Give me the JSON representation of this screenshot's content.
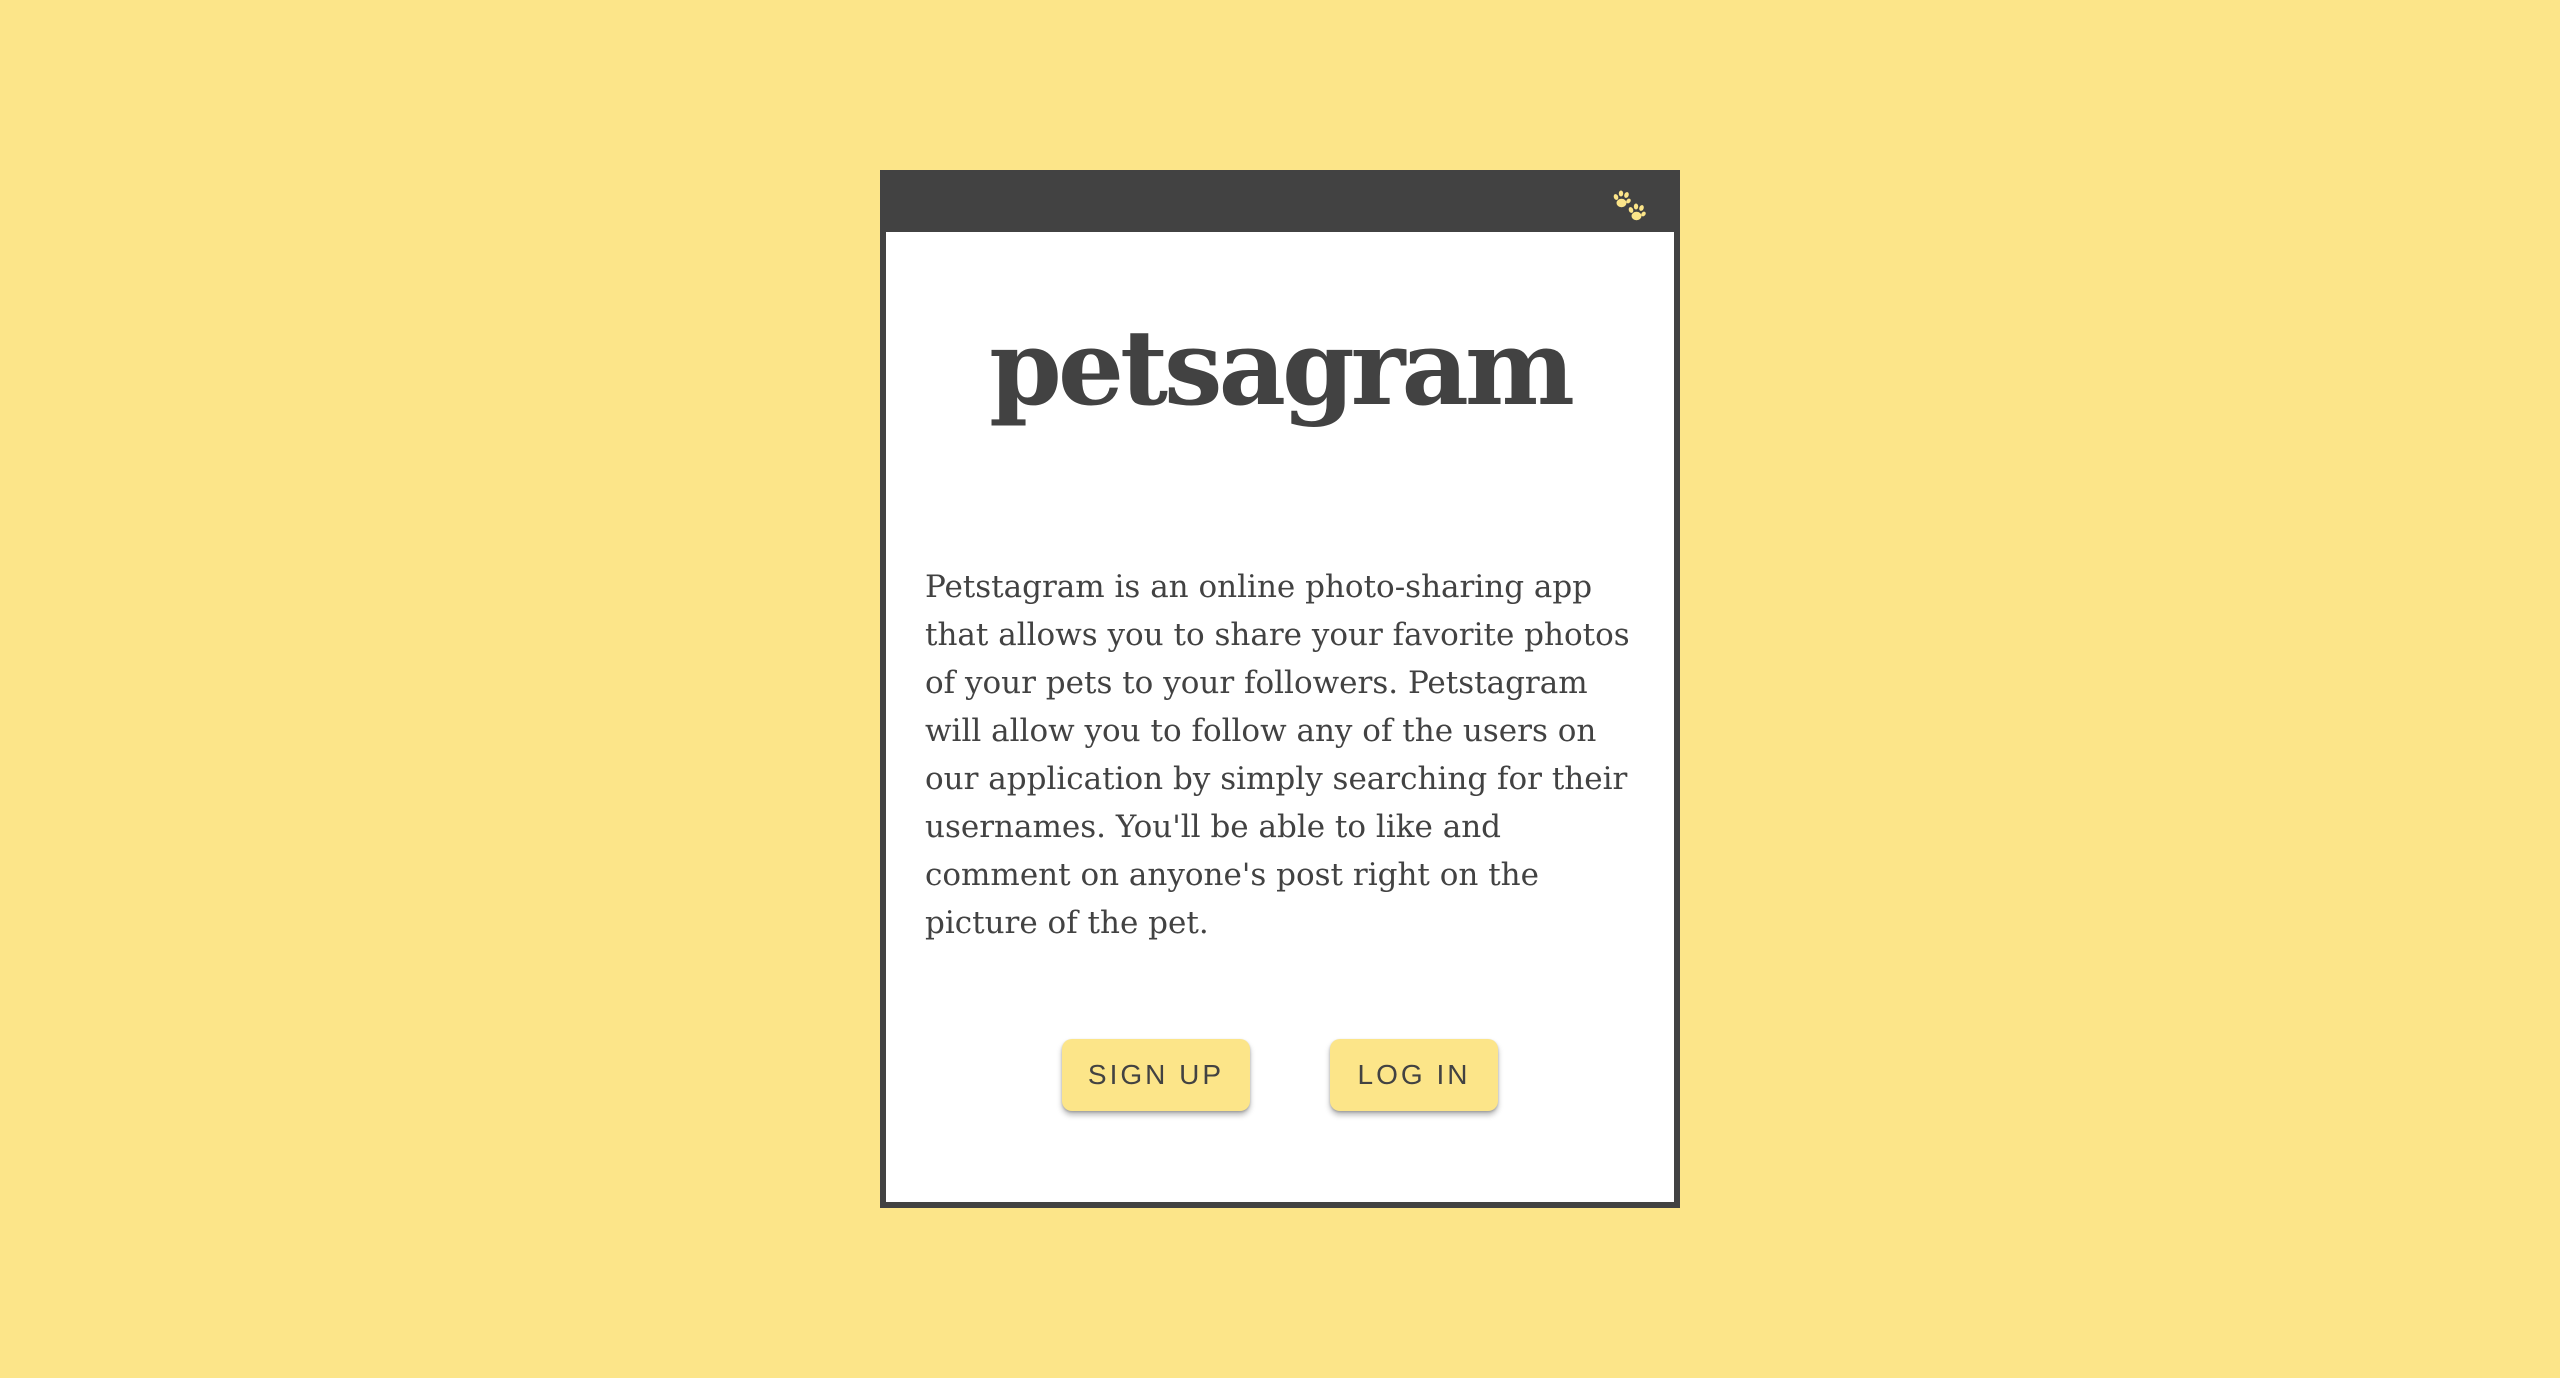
{
  "app": {
    "title": "petsagram",
    "description": "Petstagram is an online photo-sharing app that allows you to share your favorite photos of your pets to your followers. Petstagram will allow you to follow any of the users on our application by simply searching for their usernames. You'll be able to like and comment on anyone's post right on the picture of the pet."
  },
  "header": {
    "icon": "paw-icon"
  },
  "buttons": {
    "signup_label": "SIGN UP",
    "login_label": "LOG IN"
  },
  "colors": {
    "background": "#fce589",
    "header": "#424242",
    "text": "#424242",
    "button": "#fce589"
  }
}
